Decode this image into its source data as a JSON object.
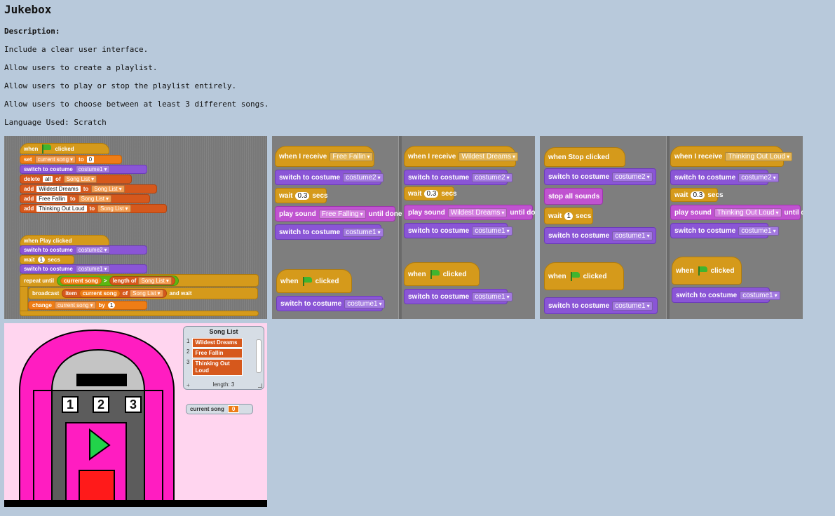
{
  "page": {
    "title": "Jukebox",
    "description_heading": "Description:",
    "lines": [
      "Include a clear user interface.",
      "Allow users to create a playlist.",
      "Allow users to play or stop the playlist entirely.",
      "Allow users to choose between at least 3 different songs.",
      "Language Used: Scratch"
    ]
  },
  "panel1": {
    "when": "when",
    "clicked": "clicked",
    "set": "set",
    "to": "to",
    "of": "of",
    "var_current_song": "current song",
    "zero": "0",
    "switch_costume": "switch to costume",
    "costume1": "costume1",
    "costume2": "costume2",
    "delete": "delete",
    "all": "all",
    "song_list": "Song List",
    "add": "add",
    "song1": "Wildest Dreams",
    "song2": "Free Fallin",
    "song3": "Thinking Out Loud",
    "when_play_clicked": "when Play clicked",
    "wait": "wait",
    "one": "1",
    "secs": "secs",
    "repeat_until": "repeat until",
    "gt": ">",
    "length_of": "length of",
    "broadcast": "broadcast",
    "item": "item",
    "and_wait": "and wait",
    "change": "change",
    "by": "by"
  },
  "panel2": {
    "when_receive": "when I receive",
    "msg_free": "Free Fallin",
    "msg_wild": "Wildest Dreams",
    "switch_costume": "switch to costume",
    "costume1": "costume1",
    "costume2": "costume2",
    "wait": "wait",
    "wait_val": "0.3",
    "secs": "secs",
    "play_sound": "play sound",
    "sound_free": "Free Falling",
    "sound_wild": "Wildest Dreams",
    "until_done": "until done",
    "when": "when",
    "clicked": "clicked"
  },
  "panel3": {
    "when_stop_clicked": "when Stop clicked",
    "stop_all": "stop all sounds",
    "switch_costume": "switch to costume",
    "costume1": "costume1",
    "costume2": "costume2",
    "wait": "wait",
    "one": "1",
    "wait_val": "0.3",
    "secs": "secs",
    "when_receive": "when I receive",
    "msg_think": "Thinking Out Loud",
    "play_sound": "play sound",
    "sound_think": "Thinking Out Loud",
    "until_done": "until done",
    "when": "when",
    "clicked": "clicked"
  },
  "stage": {
    "list_title": "Song List",
    "items": [
      {
        "index": "1",
        "value": "Wildest Dreams"
      },
      {
        "index": "2",
        "value": "Free Fallin"
      },
      {
        "index": "3",
        "value": "Thinking Out Loud"
      }
    ],
    "add_symbol": "+",
    "length_label": "length: 3",
    "var_label": "current song",
    "var_value": "0",
    "keys": [
      "1",
      "2",
      "3"
    ]
  },
  "colors": {
    "background": "#b8c9db",
    "events": "#d59a1b",
    "looks": "#8a55d6",
    "sound": "#c052d0",
    "variables": "#ee7d16",
    "lists": "#d6581c",
    "operators": "#5cb712",
    "jukebox_body": "#ff1dc1",
    "stage_bg": "#ffd5ef"
  }
}
